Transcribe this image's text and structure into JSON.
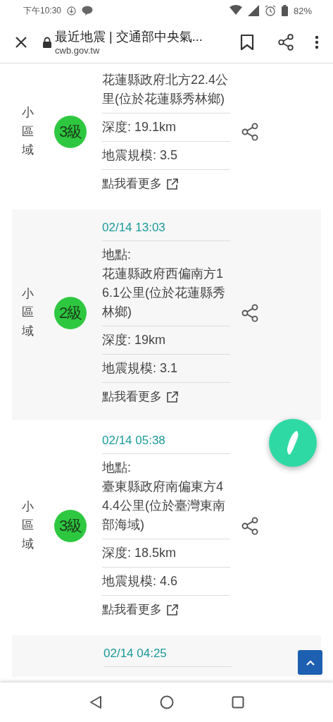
{
  "status_bar": {
    "time": "下午10:30",
    "battery": "82%"
  },
  "browser_bar": {
    "title": "最近地震 | 交通部中央氣...",
    "url": "cwb.gov.tw"
  },
  "earthquakes": [
    {
      "area": "小區域",
      "intensity": "3級",
      "location": "花蓮縣政府北方22.4公里(位於花蓮縣秀林鄉)",
      "depth": "深度: 19.1km",
      "magnitude": "地震規模: 3.5",
      "more_link": "點我看更多"
    },
    {
      "time": "02/14 13:03",
      "area": "小區域",
      "intensity": "2級",
      "location_label": "地點:",
      "location": "花蓮縣政府西偏南方16.1公里(位於花蓮縣秀林鄉)",
      "depth": "深度: 19km",
      "magnitude": "地震規模: 3.1",
      "more_link": "點我看更多"
    },
    {
      "time": "02/14 05:38",
      "area": "小區域",
      "intensity": "3級",
      "location_label": "地點:",
      "location": "臺東縣政府南偏東方44.4公里(位於臺灣東南部海域)",
      "depth": "深度: 18.5km",
      "magnitude": "地震規模: 4.6",
      "more_link": "點我看更多"
    },
    {
      "time": "02/14 04:25"
    }
  ]
}
